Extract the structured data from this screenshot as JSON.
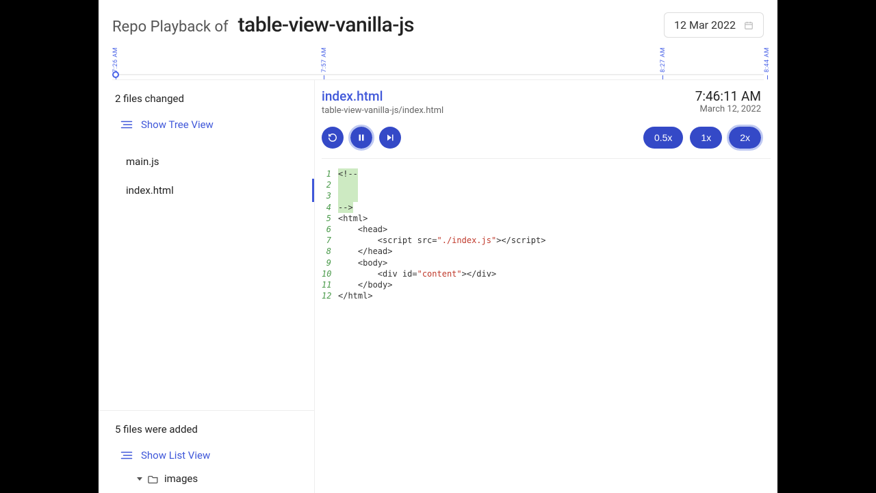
{
  "header": {
    "prefix": "Repo Playback of",
    "title": "table-view-vanilla-js",
    "date_label": "12 Mar 2022"
  },
  "timeline": {
    "ticks": [
      {
        "label": "7:26 AM",
        "pos": 0.0
      },
      {
        "label": "7:57 AM",
        "pos": 0.32
      },
      {
        "label": "8:27 AM",
        "pos": 0.84
      },
      {
        "label": "8:44 AM",
        "pos": 1.0
      }
    ],
    "playhead_pos": 0.005
  },
  "sidebar": {
    "changed_title": "2 files changed",
    "show_tree_label": "Show Tree View",
    "files": [
      "main.js",
      "index.html"
    ],
    "active_file_index": 1,
    "added_title": "5 files were added",
    "show_list_label": "Show List View",
    "tree_items": [
      "images"
    ]
  },
  "file": {
    "name": "index.html",
    "path": "table-view-vanilla-js/index.html",
    "time": "7:46:11 AM",
    "date": "March 12, 2022"
  },
  "controls": {
    "speeds": [
      "0.5x",
      "1x",
      "2x"
    ],
    "active_speed_index": 2,
    "active_play_index": 1
  },
  "code": {
    "lines": [
      {
        "n": 1,
        "hl": true,
        "segs": [
          {
            "t": "<!--"
          }
        ]
      },
      {
        "n": 2,
        "hl": true,
        "segs": [
          {
            "t": "    "
          }
        ]
      },
      {
        "n": 3,
        "hl": true,
        "segs": [
          {
            "t": "    "
          }
        ]
      },
      {
        "n": 4,
        "hl": true,
        "segs": [
          {
            "t": "-->"
          }
        ]
      },
      {
        "n": 5,
        "hl": false,
        "segs": [
          {
            "t": "<html>"
          }
        ]
      },
      {
        "n": 6,
        "hl": false,
        "segs": [
          {
            "t": "    <head>"
          }
        ]
      },
      {
        "n": 7,
        "hl": false,
        "segs": [
          {
            "t": "        <script src="
          },
          {
            "t": "\"./index.js\"",
            "cls": "str"
          },
          {
            "t": "></scr"
          },
          {
            "t": "ipt>"
          }
        ]
      },
      {
        "n": 8,
        "hl": false,
        "segs": [
          {
            "t": "    </head>"
          }
        ]
      },
      {
        "n": 9,
        "hl": false,
        "segs": [
          {
            "t": "    <body>"
          }
        ]
      },
      {
        "n": 10,
        "hl": false,
        "segs": [
          {
            "t": "        <div id="
          },
          {
            "t": "\"content\"",
            "cls": "str"
          },
          {
            "t": "></div>"
          }
        ]
      },
      {
        "n": 11,
        "hl": false,
        "segs": [
          {
            "t": "    </body>"
          }
        ]
      },
      {
        "n": 12,
        "hl": false,
        "segs": [
          {
            "t": "</html>"
          }
        ]
      }
    ]
  }
}
